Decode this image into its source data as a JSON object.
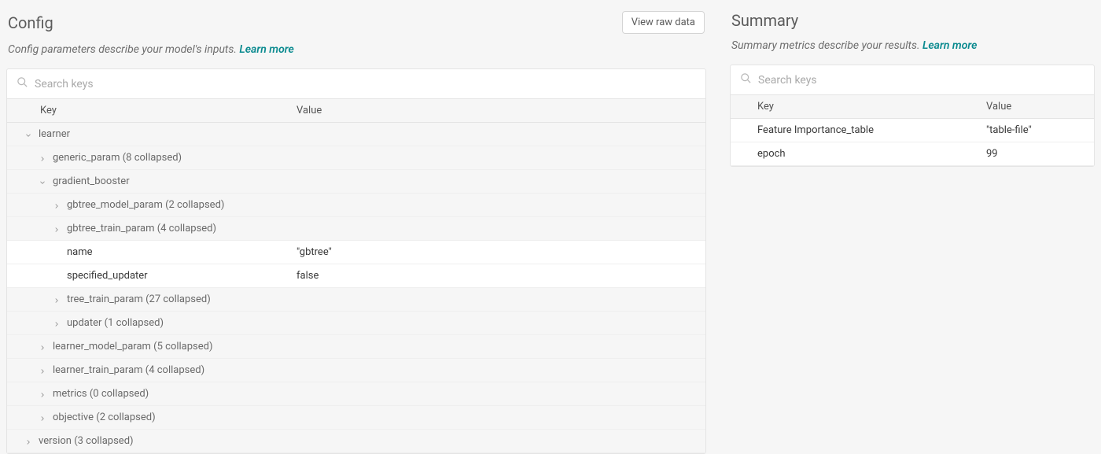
{
  "config": {
    "title": "Config",
    "viewRawLabel": "View raw data",
    "descText": "Config parameters describe your model's inputs. ",
    "learnMore": "Learn more",
    "searchPlaceholder": "Search keys",
    "headers": {
      "key": "Key",
      "value": "Value"
    },
    "rows": [
      {
        "indent": 0,
        "type": "expanded",
        "label": "learner"
      },
      {
        "indent": 1,
        "type": "collapsed",
        "label": "generic_param (8 collapsed)"
      },
      {
        "indent": 1,
        "type": "expanded",
        "label": "gradient_booster"
      },
      {
        "indent": 2,
        "type": "collapsed",
        "label": "gbtree_model_param (2 collapsed)"
      },
      {
        "indent": 2,
        "type": "collapsed",
        "label": "gbtree_train_param (4 collapsed)"
      },
      {
        "indent": 3,
        "type": "leaf",
        "label": "name",
        "value": "\"gbtree\""
      },
      {
        "indent": 3,
        "type": "leaf",
        "label": "specified_updater",
        "value": "false"
      },
      {
        "indent": 2,
        "type": "collapsed",
        "label": "tree_train_param (27 collapsed)"
      },
      {
        "indent": 2,
        "type": "collapsed",
        "label": "updater (1 collapsed)"
      },
      {
        "indent": 1,
        "type": "collapsed",
        "label": "learner_model_param (5 collapsed)"
      },
      {
        "indent": 1,
        "type": "collapsed",
        "label": "learner_train_param (4 collapsed)"
      },
      {
        "indent": 1,
        "type": "collapsed",
        "label": "metrics (0 collapsed)"
      },
      {
        "indent": 1,
        "type": "collapsed",
        "label": "objective (2 collapsed)"
      },
      {
        "indent": 0,
        "type": "collapsed",
        "label": "version (3 collapsed)"
      }
    ]
  },
  "summary": {
    "title": "Summary",
    "descText": "Summary metrics describe your results. ",
    "learnMore": "Learn more",
    "searchPlaceholder": "Search keys",
    "headers": {
      "key": "Key",
      "value": "Value"
    },
    "rows": [
      {
        "label": "Feature Importance_table",
        "value": "\"table-file\""
      },
      {
        "label": "epoch",
        "value": "99"
      }
    ]
  }
}
